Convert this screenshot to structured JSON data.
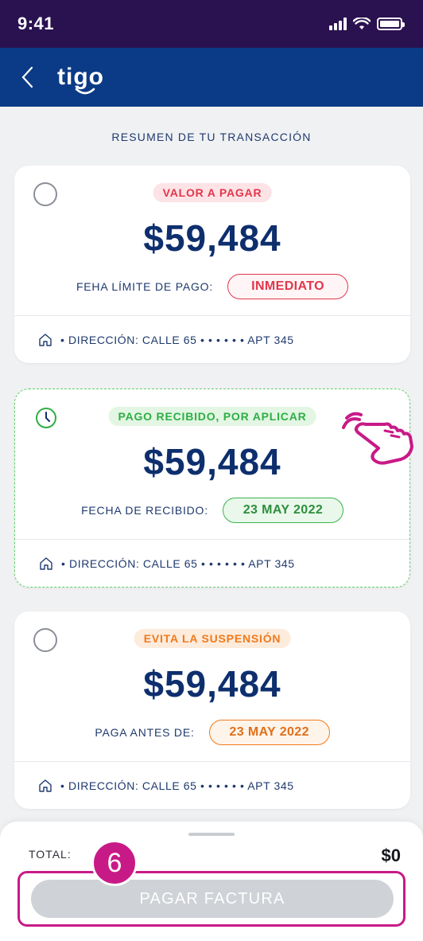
{
  "status_bar": {
    "time": "9:41"
  },
  "header": {
    "logo": "tigo"
  },
  "section_title": "RESUMEN DE TU TRANSACCIÓN",
  "cards": [
    {
      "badge": "VALOR A PAGAR",
      "amount": "$59,484",
      "date_label": "FEHA LÍMITE DE PAGO:",
      "date_value": "INMEDIATO",
      "address": "• DIRECCIÓN: CALLE 65 • • • • • • APT 345"
    },
    {
      "badge": "PAGO RECIBIDO, POR APLICAR",
      "amount": "$59,484",
      "date_label": "FECHA DE RECIBIDO:",
      "date_value": "23 MAY 2022",
      "address": "• DIRECCIÓN: CALLE 65 • • • • • • APT 345"
    },
    {
      "badge": "EVITA LA SUSPENSIÓN",
      "amount": "$59,484",
      "date_label": "PAGA ANTES DE:",
      "date_value": "23 MAY 2022",
      "address": "• DIRECCIÓN: CALLE 65 • • • • • • APT 345"
    }
  ],
  "footer": {
    "total_label": "TOTAL:",
    "total_value": "$0",
    "pay_button": "PAGAR FACTURA",
    "step_number": "6"
  },
  "colors": {
    "header_bg": "#0b3b86",
    "status_bg": "#2a1150",
    "amount": "#0e2f6e",
    "highlight": "#c81a87"
  }
}
